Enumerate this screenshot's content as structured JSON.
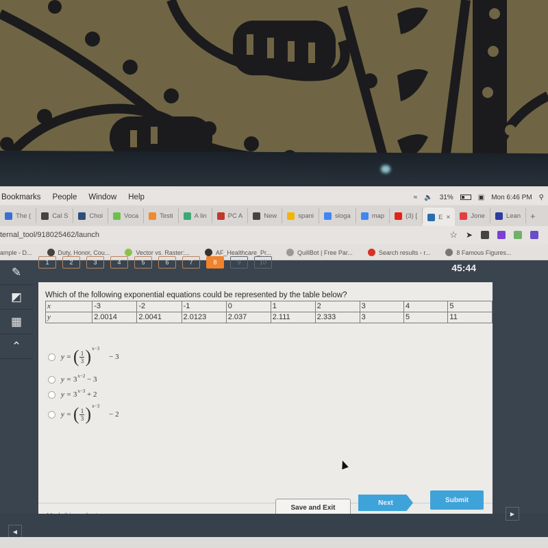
{
  "menubar": {
    "items": [
      "Bookmarks",
      "People",
      "Window",
      "Help"
    ],
    "battery": "31%",
    "clock": "Mon 6:46 PM"
  },
  "tabs": [
    {
      "label": "The (",
      "color": "#3b6fd1"
    },
    {
      "label": "Cal S",
      "color": "#444444"
    },
    {
      "label": "Choi",
      "color": "#2d4d7a"
    },
    {
      "label": "Voca",
      "color": "#6cc04a"
    },
    {
      "label": "Testi",
      "color": "#f08a2c"
    },
    {
      "label": "A lin",
      "color": "#3fa876"
    },
    {
      "label": "PC A",
      "color": "#c0392b"
    },
    {
      "label": "New",
      "color": "#444444"
    },
    {
      "label": "spani",
      "color": "#f4b400"
    },
    {
      "label": "sloga",
      "color": "#4285f4"
    },
    {
      "label": "map",
      "color": "#4285f4"
    },
    {
      "label": "(3) [",
      "color": "#e62117"
    },
    {
      "label": "E",
      "color": "#2b6cb0",
      "active": true
    },
    {
      "label": "Jone",
      "color": "#e04040"
    },
    {
      "label": "Lean",
      "color": "#2d3a9e"
    }
  ],
  "address": {
    "url": "ternal_tool/918025462/launch"
  },
  "bookmarks": [
    {
      "label": "ample - D...",
      "color": "transparent"
    },
    {
      "label": "Duty, Honor, Cou...",
      "color": "#444444"
    },
    {
      "label": "Vector vs. Raster:...",
      "color": "#8bc34a"
    },
    {
      "label": "AF_Healthcare_Pr...",
      "color": "#333333"
    },
    {
      "label": "QuillBot | Free Par...",
      "color": "#999999"
    },
    {
      "label": "Search results - r...",
      "color": "#d93025"
    },
    {
      "label": "8 Famous Figures...",
      "color": "#777777"
    }
  ],
  "quiz": {
    "question_numbers": [
      "1",
      "2",
      "3",
      "4",
      "5",
      "6",
      "7",
      "8",
      "9",
      "10"
    ],
    "current_question": "8",
    "timer": "45:44",
    "question": "Which of the following exponential equations could be represented by the table below?",
    "table": {
      "x_label": "x",
      "y_label": "y",
      "x": [
        "-3",
        "-2",
        "-1",
        "0",
        "1",
        "2",
        "3",
        "4",
        "5"
      ],
      "y": [
        "2.0014",
        "2.0041",
        "2.0123",
        "2.037",
        "2.111",
        "2.333",
        "3",
        "5",
        "11"
      ]
    },
    "options": [
      {
        "text": "y = (1/3)^(x-3) - 3",
        "lhs": "y =",
        "base_num": "1",
        "base_den": "3",
        "exp": "x−3",
        "tail": "− 3"
      },
      {
        "text": "y = 3^(x-2) - 3",
        "lhs": "y =",
        "base": "3",
        "exp": "x−2",
        "tail": "− 3"
      },
      {
        "text": "y = 3^(x-3) + 2",
        "lhs": "y =",
        "base": "3",
        "exp": "x−3",
        "tail": "+ 2"
      },
      {
        "text": "y = (1/3)^(x-3) - 2",
        "lhs": "y =",
        "base_num": "1",
        "base_den": "3",
        "exp": "x−3",
        "tail": "− 2"
      }
    ],
    "mark_link": "Mark this and return",
    "save_exit": "Save and Exit",
    "next": "Next",
    "submit": "Submit"
  },
  "colors": {
    "active_question": "#f0832b",
    "primary_button": "#3ea3d9"
  }
}
